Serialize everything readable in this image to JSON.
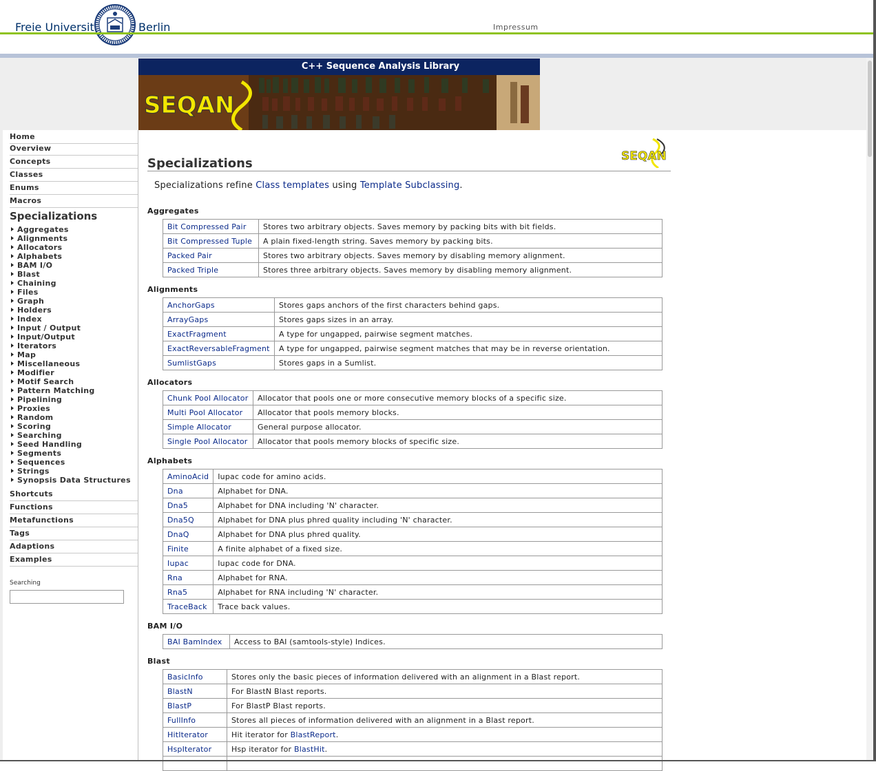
{
  "header": {
    "university_left": "Freie Universität",
    "university_right": "Berlin",
    "impressum": "Impressum"
  },
  "banner": {
    "title": "C++ Sequence Analysis Library",
    "logo_text": "SEQAN"
  },
  "sidebar": {
    "top_items": [
      "Home",
      "Overview",
      "Concepts",
      "Classes",
      "Enums",
      "Macros"
    ],
    "current": "Specializations",
    "sub_items": [
      "Aggregates",
      "Alignments",
      "Allocators",
      "Alphabets",
      "BAM I/O",
      "Blast",
      "Chaining",
      "Files",
      "Graph",
      "Holders",
      "Index",
      "Input / Output",
      "Input/Output",
      "Iterators",
      "Map",
      "Miscellaneous",
      "Modifier",
      "Motif Search",
      "Pattern Matching",
      "Pipelining",
      "Proxies",
      "Random",
      "Scoring",
      "Searching",
      "Seed Handling",
      "Segments",
      "Sequences",
      "Strings",
      "Synopsis Data Structures"
    ],
    "bottom_items": [
      "Shortcuts",
      "Functions",
      "Metafunctions",
      "Tags",
      "Adaptions",
      "Examples"
    ],
    "search_label": "Searching",
    "search_value": ""
  },
  "main": {
    "title": "Specializations",
    "logo_text": "SEQAN",
    "intro_prefix": "Specializations refine ",
    "intro_link1": "Class templates",
    "intro_middle": " using ",
    "intro_link2": "Template Subclassing",
    "intro_suffix": ".",
    "sections": [
      {
        "heading": "Aggregates",
        "rows": [
          {
            "name": "Bit Compressed Pair",
            "desc": "Stores two arbitrary objects. Saves memory by packing bits with bit fields."
          },
          {
            "name": "Bit Compressed Tuple",
            "desc": "A plain fixed-length string. Saves memory by packing bits."
          },
          {
            "name": "Packed Pair",
            "desc": "Stores two arbitrary objects. Saves memory by disabling memory alignment."
          },
          {
            "name": "Packed Triple",
            "desc": "Stores three arbitrary objects. Saves memory by disabling memory alignment."
          }
        ]
      },
      {
        "heading": "Alignments",
        "rows": [
          {
            "name": "AnchorGaps",
            "desc": "Stores gaps anchors of the first characters behind gaps."
          },
          {
            "name": "ArrayGaps",
            "desc": "Stores gaps sizes in an array."
          },
          {
            "name": "ExactFragment",
            "desc": "A type for ungapped, pairwise segment matches."
          },
          {
            "name": "ExactReversableFragment",
            "desc": "A type for ungapped, pairwise segment matches that may be in reverse orientation."
          },
          {
            "name": "SumlistGaps",
            "desc": "Stores gaps in a Sumlist."
          }
        ]
      },
      {
        "heading": "Allocators",
        "rows": [
          {
            "name": "Chunk Pool Allocator",
            "desc": "Allocator that pools one or more consecutive memory blocks of a specific size."
          },
          {
            "name": "Multi Pool Allocator",
            "desc": "Allocator that pools memory blocks."
          },
          {
            "name": "Simple Allocator",
            "desc": "General purpose allocator."
          },
          {
            "name": "Single Pool Allocator",
            "desc": "Allocator that pools memory blocks of specific size."
          }
        ]
      },
      {
        "heading": "Alphabets",
        "rows": [
          {
            "name": "AminoAcid",
            "desc": "Iupac code for amino acids."
          },
          {
            "name": "Dna",
            "desc": "Alphabet for DNA."
          },
          {
            "name": "Dna5",
            "desc": "Alphabet for DNA including 'N' character."
          },
          {
            "name": "Dna5Q",
            "desc": "Alphabet for DNA plus phred quality including 'N' character."
          },
          {
            "name": "DnaQ",
            "desc": "Alphabet for DNA plus phred quality."
          },
          {
            "name": "Finite",
            "desc": "A finite alphabet of a fixed size."
          },
          {
            "name": "Iupac",
            "desc": "Iupac code for DNA."
          },
          {
            "name": "Rna",
            "desc": "Alphabet for RNA."
          },
          {
            "name": "Rna5",
            "desc": "Alphabet for RNA including 'N' character."
          },
          {
            "name": "TraceBack",
            "desc": "Trace back values."
          }
        ]
      },
      {
        "heading": "BAM I/O",
        "rows": [
          {
            "name": "BAI BamIndex",
            "desc": "Access to BAI (samtools-style) Indices."
          }
        ]
      },
      {
        "heading": "Blast",
        "rows": [
          {
            "name": "BasicInfo",
            "desc": "Stores only the basic pieces of information delivered with an alignment in a Blast report."
          },
          {
            "name": "BlastN",
            "desc": "For BlastN Blast reports."
          },
          {
            "name": "BlastP",
            "desc": "For BlastP Blast reports."
          },
          {
            "name": "FullInfo",
            "desc": "Stores all pieces of information delivered with an alignment in a Blast report."
          },
          {
            "name": "HitIterator",
            "desc": "Hit iterator for ",
            "link": "BlastReport",
            "after": "."
          },
          {
            "name": "HspIterator",
            "desc": "Hsp iterator for ",
            "link": "BlastHit",
            "after": "."
          }
        ]
      }
    ]
  }
}
